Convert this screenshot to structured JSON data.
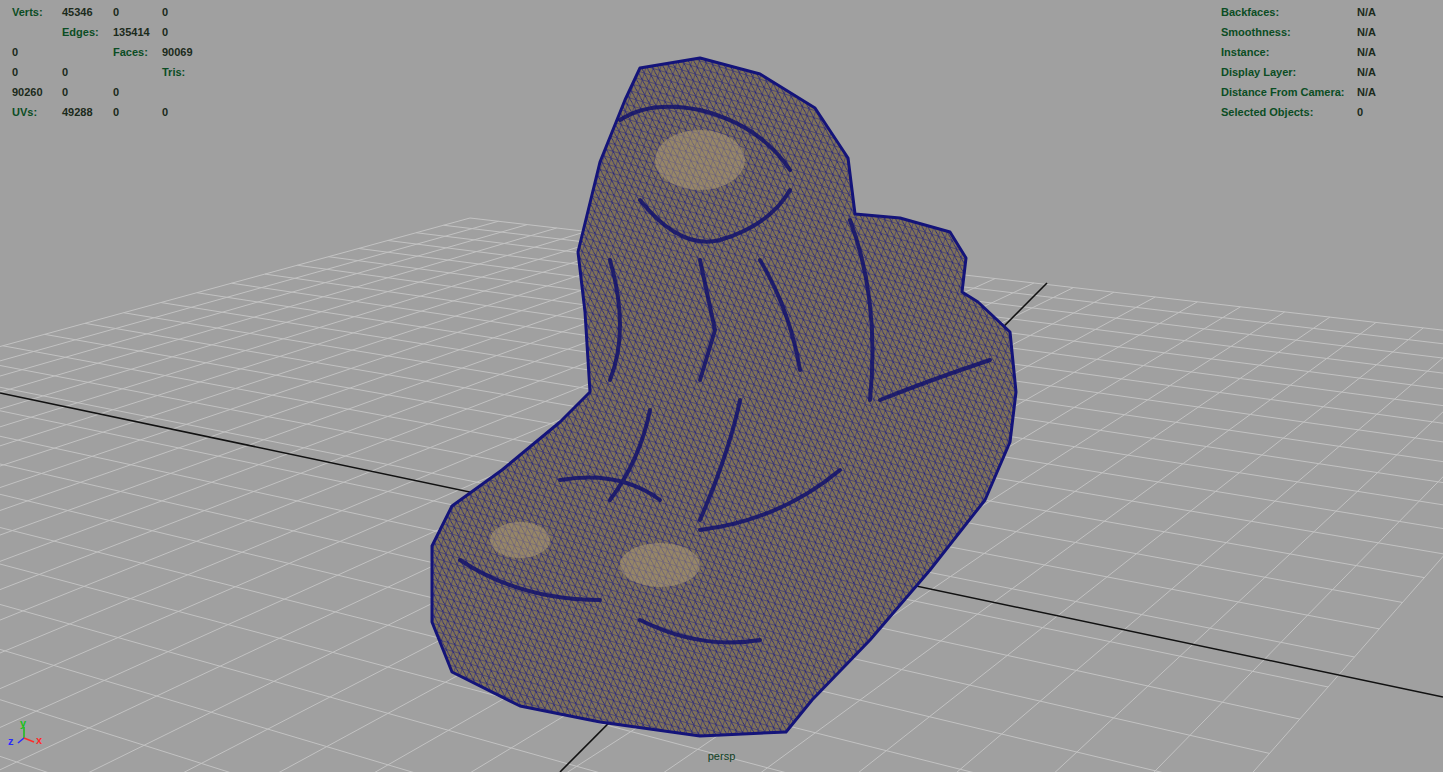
{
  "hud_left": [
    {
      "label": "Verts:",
      "values": [
        "45346",
        "0",
        "0"
      ]
    },
    {
      "label": "Edges:",
      "values": [
        "135414",
        "0",
        "0"
      ]
    },
    {
      "label": "Faces:",
      "values": [
        "90069",
        "0",
        "0"
      ]
    },
    {
      "label": "Tris:",
      "values": [
        "90260",
        "0",
        "0"
      ]
    },
    {
      "label": "UVs:",
      "values": [
        "49288",
        "0",
        "0"
      ]
    }
  ],
  "hud_right": [
    {
      "label": "Backfaces:",
      "value": "N/A"
    },
    {
      "label": "Smoothness:",
      "value": "N/A"
    },
    {
      "label": "Instance:",
      "value": "N/A"
    },
    {
      "label": "Display Layer:",
      "value": "N/A"
    },
    {
      "label": "Distance From Camera:",
      "value": "N/A"
    },
    {
      "label": "Selected Objects:",
      "value": "0"
    }
  ],
  "camera": "persp",
  "axes": [
    {
      "label": "y",
      "color": "#18c018"
    },
    {
      "label": "z",
      "color": "#2a2aff"
    },
    {
      "label": "x",
      "color": "#ff2a2a"
    }
  ]
}
